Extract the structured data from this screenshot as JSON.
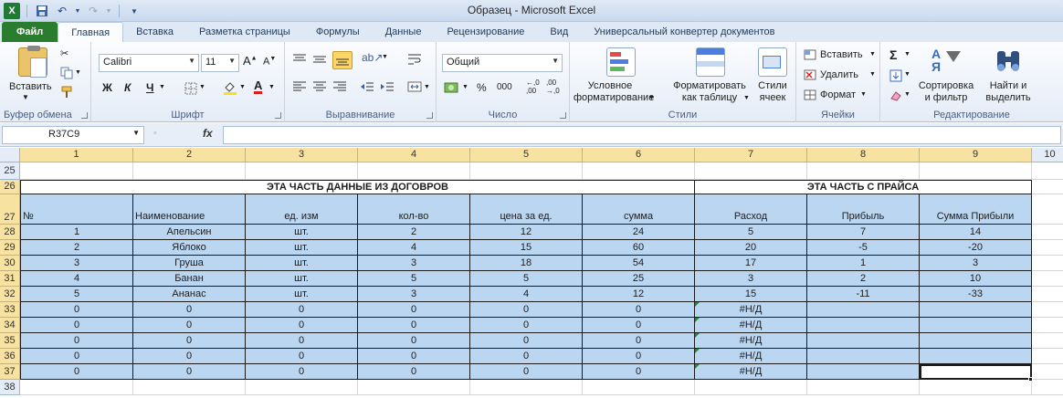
{
  "window": {
    "title": "Образец  -  Microsoft Excel"
  },
  "tabs": [
    "Файл",
    "Главная",
    "Вставка",
    "Разметка страницы",
    "Формулы",
    "Данные",
    "Рецензирование",
    "Вид",
    "Универсальный конвертер документов"
  ],
  "ribbon": {
    "clipboard": {
      "label": "Буфер обмена",
      "paste": "Вставить"
    },
    "font": {
      "label": "Шрифт",
      "name": "Calibri",
      "size": "11",
      "bold": "Ж",
      "italic": "К",
      "underline": "Ч"
    },
    "alignment": {
      "label": "Выравнивание"
    },
    "number": {
      "label": "Число",
      "format": "Общий",
      "percent": "%",
      "thousands": "000"
    },
    "styles": {
      "label": "Стили",
      "conditional": [
        "Условное",
        "форматирование"
      ],
      "format_table": [
        "Форматировать",
        "как таблицу"
      ],
      "cell_styles": [
        "Стили",
        "ячеек"
      ]
    },
    "cells": {
      "label": "Ячейки",
      "insert": "Вставить",
      "delete": "Удалить",
      "format": "Формат"
    },
    "editing": {
      "label": "Редактирование",
      "sort": [
        "Сортировка",
        "и фильтр"
      ],
      "find": [
        "Найти и",
        "выделить"
      ]
    }
  },
  "formula_bar": {
    "name_box": "R37C9",
    "fx": "fx",
    "formula": ""
  },
  "grid": {
    "columns": [
      "1",
      "2",
      "3",
      "4",
      "5",
      "6",
      "7",
      "8",
      "9",
      "10"
    ],
    "rows": [
      "25",
      "26",
      "27",
      "28",
      "29",
      "30",
      "31",
      "32",
      "33",
      "34",
      "35",
      "36",
      "37",
      "38"
    ],
    "section_left": "ЭТА ЧАСТЬ ДАННЫЕ ИЗ ДОГОВРОВ",
    "section_right": "ЭТА ЧАСТЬ С ПРАЙСА",
    "headers": [
      "№",
      "Наименование",
      "ед. изм",
      "кол-во",
      "цена за ед.",
      "сумма",
      "Расход",
      "Прибыль",
      "Сумма Прибыли"
    ],
    "data": [
      [
        "1",
        "Апельсин",
        "шт.",
        "2",
        "12",
        "24",
        "5",
        "7",
        "14"
      ],
      [
        "2",
        "Яблоко",
        "шт.",
        "4",
        "15",
        "60",
        "20",
        "-5",
        "-20"
      ],
      [
        "3",
        "Груша",
        "шт.",
        "3",
        "18",
        "54",
        "17",
        "1",
        "3"
      ],
      [
        "4",
        "Банан",
        "шт.",
        "5",
        "5",
        "25",
        "3",
        "2",
        "10"
      ],
      [
        "5",
        "Ананас",
        "шт.",
        "3",
        "4",
        "12",
        "15",
        "-11",
        "-33"
      ],
      [
        "0",
        "0",
        "0",
        "0",
        "0",
        "0",
        "#Н/Д",
        "",
        ""
      ],
      [
        "0",
        "0",
        "0",
        "0",
        "0",
        "0",
        "#Н/Д",
        "",
        ""
      ],
      [
        "0",
        "0",
        "0",
        "0",
        "0",
        "0",
        "#Н/Д",
        "",
        ""
      ],
      [
        "0",
        "0",
        "0",
        "0",
        "0",
        "0",
        "#Н/Д",
        "",
        ""
      ],
      [
        "0",
        "0",
        "0",
        "0",
        "0",
        "0",
        "#Н/Д",
        "",
        ""
      ]
    ]
  }
}
